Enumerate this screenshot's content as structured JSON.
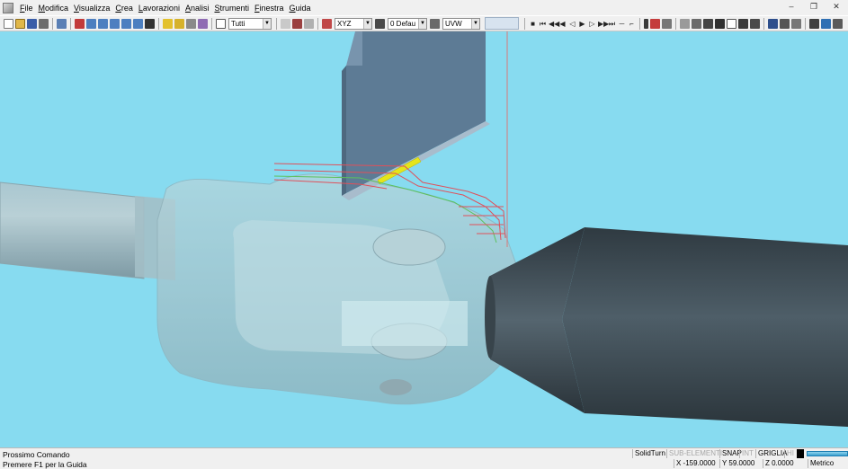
{
  "menu": {
    "items": [
      {
        "label": "File",
        "u": "F",
        "rest": "ile"
      },
      {
        "label": "Modifica",
        "u": "M",
        "rest": "odifica"
      },
      {
        "label": "Visualizza",
        "u": "V",
        "rest": "isualizza"
      },
      {
        "label": "Crea",
        "u": "C",
        "rest": "rea"
      },
      {
        "label": "Lavorazioni",
        "u": "L",
        "rest": "avorazioni"
      },
      {
        "label": "Analisi",
        "u": "A",
        "rest": "nalisi"
      },
      {
        "label": "Strumenti",
        "u": "S",
        "rest": "trumenti"
      },
      {
        "label": "Finestra",
        "u": "F",
        "rest": "inestra"
      },
      {
        "label": "Guida",
        "u": "G",
        "rest": "uida"
      }
    ]
  },
  "window_controls": {
    "minimize": "–",
    "restore": "❐",
    "close": "✕"
  },
  "toolbar": {
    "filter_combo": "Tutti",
    "plane_combo": "XYZ",
    "view_combo": "0 Defau",
    "axes_combo": "UVW"
  },
  "status": {
    "line1": "Prossimo Comando",
    "line2": "Premere F1 per la Guida",
    "mode": "SolidTurn",
    "sub_elements": "SUB-ELEMENTI",
    "snap": "SNAP",
    "int": "INT",
    "grid": "GRIGLIA",
    "hi": "HI",
    "x": "X -159.0000",
    "y": "Y 59.0000",
    "z": "Z 0.0000",
    "units": "Metrico"
  },
  "colors": {
    "viewport_bg": "#87dbf0",
    "tool_holder": "#5f7d98",
    "insert": "#e8e81a",
    "toolpath_red": "#e0505a",
    "toolpath_green": "#5cc15c",
    "tailstock": "#3d4a52"
  }
}
